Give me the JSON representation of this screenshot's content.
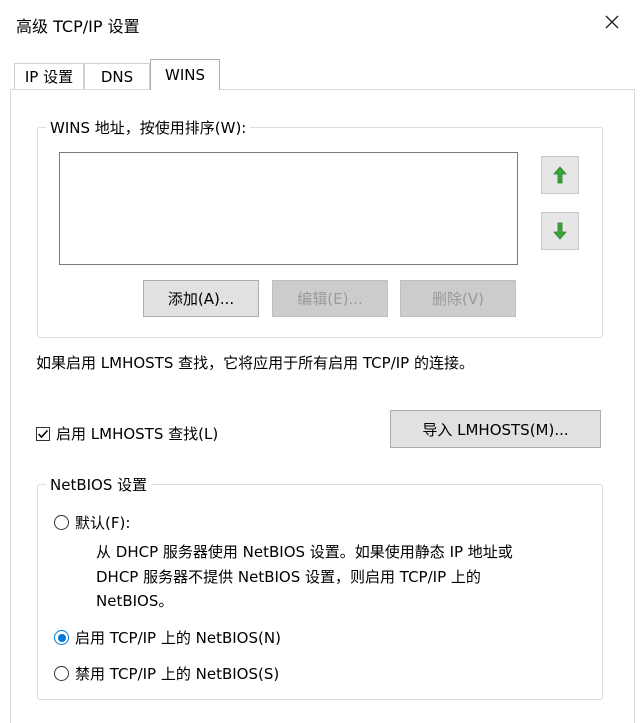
{
  "window": {
    "title": "高级 TCP/IP 设置"
  },
  "tabs": [
    {
      "label": "IP 设置"
    },
    {
      "label": "DNS"
    },
    {
      "label": "WINS"
    }
  ],
  "wins": {
    "group_label": "WINS 地址，按使用排序(W):",
    "addresses": [],
    "add_button": "添加(A)...",
    "edit_button": "编辑(E)...",
    "delete_button": "删除(V)"
  },
  "lmhosts": {
    "info": "如果启用 LMHOSTS 查找，它将应用于所有启用 TCP/IP 的连接。",
    "enable_label": "启用 LMHOSTS 查找(L)",
    "enable_checked": true,
    "import_button": "导入 LMHOSTS(M)..."
  },
  "netbios": {
    "group_label": "NetBIOS 设置",
    "default_label": "默认(F):",
    "default_desc": [
      "从 DHCP 服务器使用 NetBIOS 设置。如果使用静态 IP 地址或",
      "DHCP 服务器不提供 NetBIOS 设置，则启用 TCP/IP 上的",
      "NetBIOS。"
    ],
    "enable_label": "启用 TCP/IP 上的 NetBIOS(N)",
    "disable_label": "禁用 TCP/IP 上的 NetBIOS(S)",
    "selected": "enable"
  },
  "colors": {
    "accent": "#0078d7",
    "arrow_green": "#3aa53a"
  }
}
